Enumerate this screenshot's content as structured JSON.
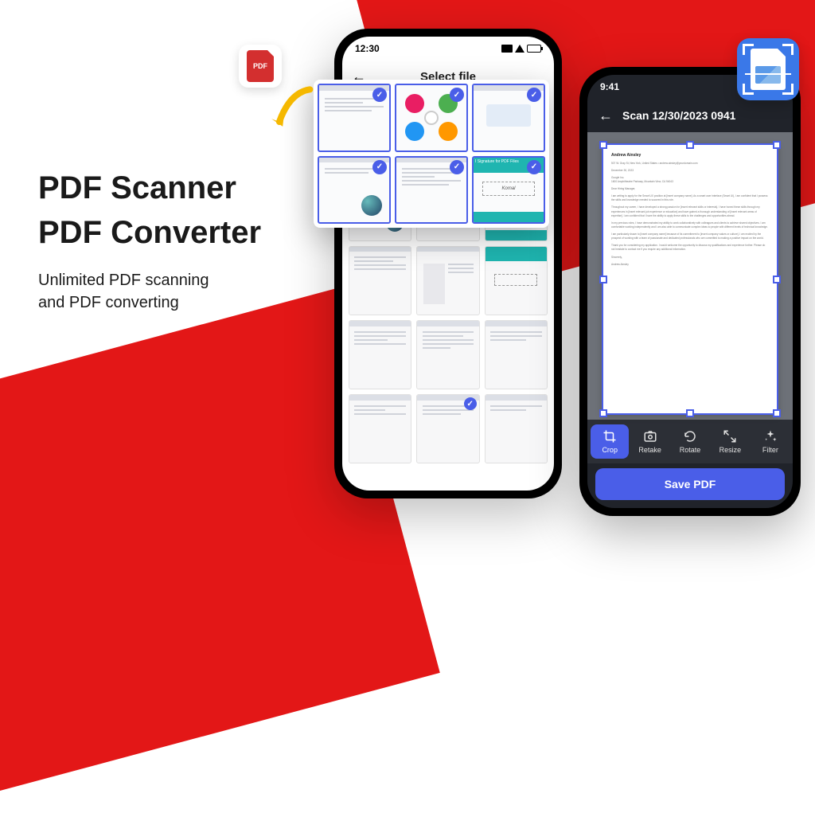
{
  "marketing": {
    "headline1": "PDF Scanner",
    "headline2": "PDF Converter",
    "sub_line1": "Unlimited PDF scanning",
    "sub_line2": "and PDF converting"
  },
  "pdf_badge": {
    "label": "PDF"
  },
  "phone1": {
    "status_time": "12:30",
    "header_title": "Select file"
  },
  "phone2": {
    "status_time": "9:41",
    "scan_title": "Scan 12/30/2023 0941",
    "doc_from": "Andrew Ainsley",
    "tools": {
      "crop": "Crop",
      "retake": "Retake",
      "rotate": "Rotate",
      "resize": "Resize",
      "filter": "Filter"
    },
    "save_label": "Save PDF"
  }
}
